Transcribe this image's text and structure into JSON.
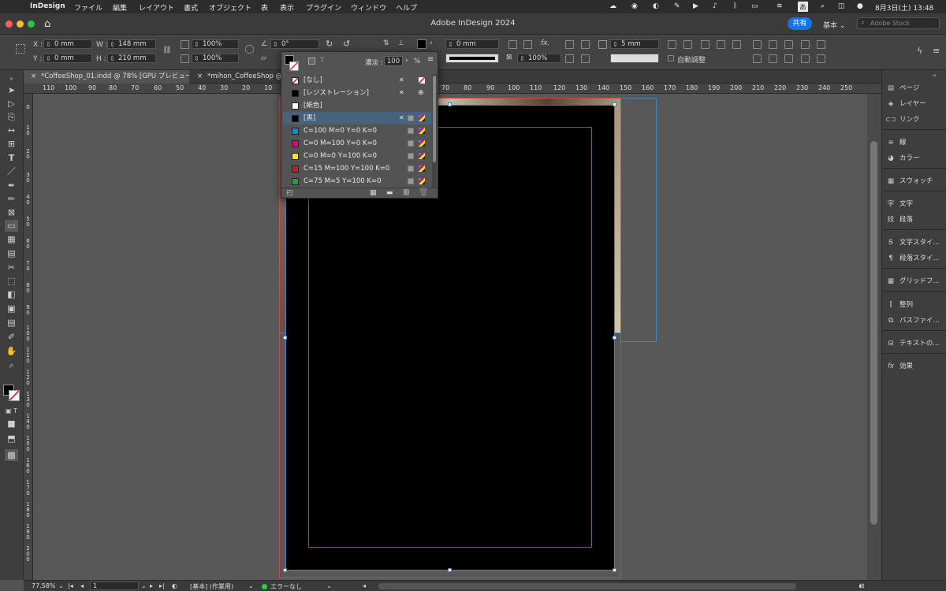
{
  "menubar": {
    "app": "InDesign",
    "items": [
      "ファイル",
      "編集",
      "レイアウト",
      "書式",
      "オブジェクト",
      "表",
      "表示",
      "プラグイン",
      "ウィンドウ",
      "ヘルプ"
    ],
    "ime": "あ",
    "datetime": "8月3日(土) 13:48"
  },
  "titlebar": {
    "title": "Adobe InDesign 2024",
    "share_label": "共有",
    "workspace_label": "基本",
    "search_placeholder": "Adobe Stock"
  },
  "control": {
    "x_label": "X :",
    "x_value": "0 mm",
    "y_label": "Y :",
    "y_value": "0 mm",
    "w_label": "W :",
    "w_value": "148 mm",
    "h_label": "H :",
    "h_value": "210 mm",
    "scale_x": "100%",
    "scale_y": "100%",
    "rotation": "0°",
    "stroke_weight": "0 mm",
    "opacity": "100%",
    "spacing": "5 mm",
    "autofit_label": "自動調整"
  },
  "tabs": [
    {
      "label": "*CoffeeShop_01.indd @ 78% [GPU プレビュー]"
    },
    {
      "label": "*mihon_CoffeeShop @ 7"
    }
  ],
  "ruler_h": [
    "110",
    "100",
    "90",
    "80",
    "70",
    "60",
    "50",
    "40",
    "30",
    "20",
    "10",
    "70",
    "80",
    "90",
    "100",
    "110",
    "120",
    "130",
    "140",
    "150",
    "160",
    "170",
    "180",
    "190",
    "200",
    "210",
    "220",
    "230",
    "240",
    "250"
  ],
  "ruler_v": [
    "0",
    "1 0",
    "2 0",
    "3 0",
    "4 0",
    "5 0",
    "6 0",
    "7 0",
    "8 0",
    "9 0",
    "1 0 0",
    "1 1 0",
    "1 2 0",
    "1 3 0",
    "1 4 0",
    "1 5 0",
    "1 6 0",
    "1 7 0",
    "1 8 0",
    "1 9 0",
    "2 0 0"
  ],
  "swatches": {
    "tint_label": "濃淡 :",
    "tint_value": "100",
    "percent": "%",
    "rows": [
      {
        "name": "[なし]",
        "color": "none"
      },
      {
        "name": "[レジストレーション]",
        "color": "#000000"
      },
      {
        "name": "[紙色]",
        "color": "#ffffff"
      },
      {
        "name": "[黒]",
        "color": "#000000",
        "selected": true
      },
      {
        "name": "C=100 M=0 Y=0 K=0",
        "color": "#0093d6"
      },
      {
        "name": "C=0 M=100 Y=0 K=0",
        "color": "#e4007f"
      },
      {
        "name": "C=0 M=0 Y=100 K=0",
        "color": "#ffe800"
      },
      {
        "name": "C=15 M=100 Y=100 K=0",
        "color": "#cc1a1f"
      },
      {
        "name": "C=75 M=5 Y=100 K=0",
        "color": "#2a9a3b"
      }
    ]
  },
  "panels": [
    {
      "label": "ページ",
      "icon": "pages-icon"
    },
    {
      "label": "レイヤー",
      "icon": "layers-icon"
    },
    {
      "label": "リンク",
      "icon": "links-icon"
    },
    {
      "label": "線",
      "icon": "stroke-icon"
    },
    {
      "label": "カラー",
      "icon": "color-icon"
    },
    {
      "label": "スウォッチ",
      "icon": "swatches-icon"
    },
    {
      "label": "文字",
      "icon": "character-icon"
    },
    {
      "label": "段落",
      "icon": "paragraph-icon"
    },
    {
      "label": "文字スタイ...",
      "icon": "character-styles-icon"
    },
    {
      "label": "段落スタイ...",
      "icon": "paragraph-styles-icon"
    },
    {
      "label": "グリッドフ...",
      "icon": "grid-format-icon"
    },
    {
      "label": "整列",
      "icon": "align-icon"
    },
    {
      "label": "パスファイ...",
      "icon": "pathfinder-icon"
    },
    {
      "label": "テキストの...",
      "icon": "text-wrap-icon"
    },
    {
      "label": "効果",
      "icon": "effects-icon"
    }
  ],
  "status": {
    "zoom": "77.58%",
    "page": "1",
    "master": "[基本] (作業用)",
    "preflight": "エラーなし"
  },
  "colors": {
    "accent": "#1473e6",
    "selection": "#46627d",
    "page": "#000000"
  }
}
